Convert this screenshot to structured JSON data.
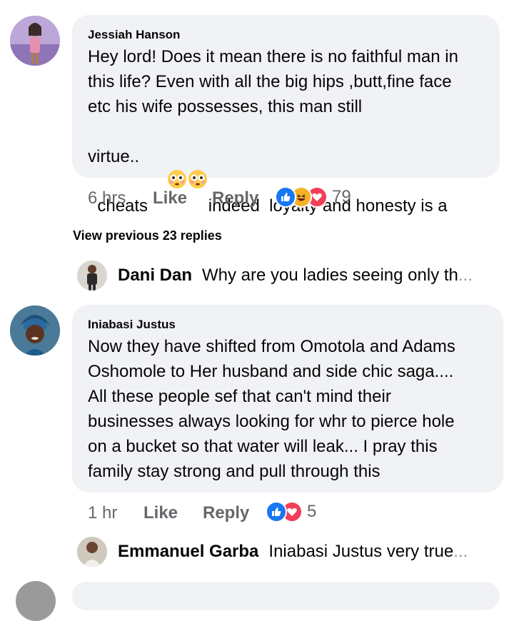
{
  "comments": [
    {
      "author": "Jessiah Hanson",
      "text_lines": [
        "Hey lord! Does it mean there is no faithful man in",
        "this life? Even with all the big hips ,butt,fine face",
        "etc his wife possesses, this man still",
        "cheats",
        "indeed  loyalty and honesty is a",
        "virtue.."
      ],
      "emoji": "😳😳",
      "time": "6 hrs",
      "like": "Like",
      "reply": "Reply",
      "reaction_count": "79",
      "reactions": [
        "like-icon",
        "haha-icon",
        "love-icon"
      ]
    },
    {
      "author": "Iniabasi Justus",
      "text_lines": [
        "Now they have shifted from Omotola and Adams",
        "Oshomole to Her husband and side chic saga....",
        "All these people sef that can't mind their",
        "businesses always looking for whr to pierce hole",
        "on a bucket so that water will leak... I pray this",
        "family stay strong and pull through this"
      ],
      "time": "1 hr",
      "like": "Like",
      "reply": "Reply",
      "reaction_count": "5",
      "reactions": [
        "like-icon",
        "love-icon"
      ]
    }
  ],
  "view_previous": "View previous 23 replies",
  "replies": [
    {
      "name": "Dani Dan",
      "text": "Why are you ladies seeing only th",
      "ellipsis": "..."
    },
    {
      "name": "Emmanuel Garba",
      "text": "Iniabasi Justus very true",
      "ellipsis": "..."
    }
  ],
  "colors": {
    "bubble": "#f0f2f5",
    "meta": "#65676b",
    "like_blue": "#1877f2",
    "love_red": "#f33e58",
    "haha_yellow": "#f7b125"
  }
}
